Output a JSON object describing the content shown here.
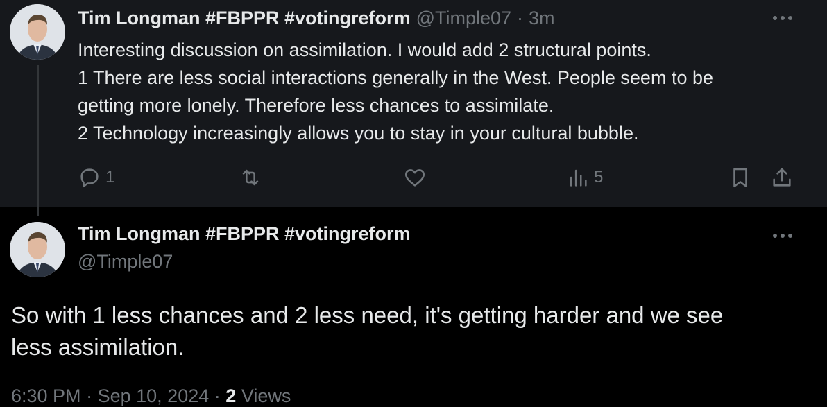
{
  "reply": {
    "author_name": "Tim Longman #FBPPR #votingreform",
    "author_handle": "@Timple07",
    "separator": "·",
    "time_ago": "3m",
    "lines": [
      "Interesting discussion on assimilation. I would add 2 structural points.",
      "1 There are less social interactions generally in the West. People seem to be",
      "getting more lonely. Therefore less chances to assimilate.",
      "2 Technology increasingly allows you to stay in your cultural bubble."
    ],
    "reply_count": "1",
    "views_count": "5",
    "icons": [
      "reply-icon",
      "retweet-icon",
      "like-icon",
      "views-icon",
      "bookmark-icon",
      "share-icon",
      "more-icon"
    ]
  },
  "main": {
    "author_name": "Tim Longman #FBPPR #votingreform",
    "author_handle": "@Timple07",
    "lines": [
      "So with 1 less chances and 2 less need, it's getting harder and we see",
      "less assimilation."
    ],
    "time": "6:30 PM",
    "date": "Sep 10, 2024",
    "separator": "·",
    "views_count": "2",
    "views_label": "Views"
  },
  "colors": {
    "background": "#000000",
    "reply_background": "#16181c",
    "text": "#e7e9ea",
    "muted": "#71767b"
  }
}
